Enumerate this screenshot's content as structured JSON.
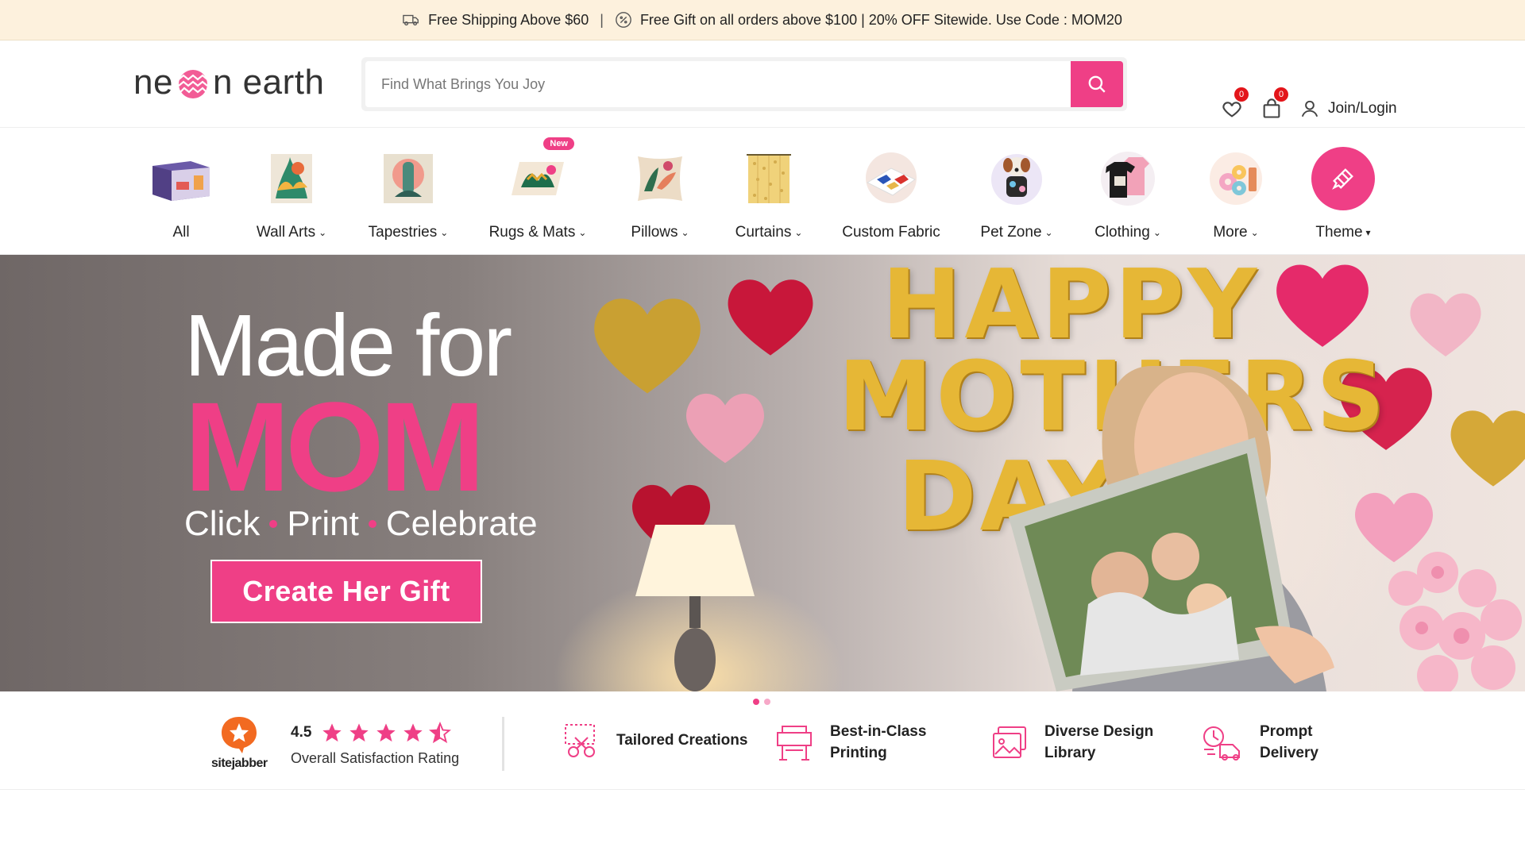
{
  "topbar": {
    "shipping": "Free Shipping Above $60",
    "separator": "|",
    "promo": "Free Gift on all orders above $100 | 20% OFF Sitewide. Use Code : MOM20"
  },
  "header": {
    "logo_left": "ne",
    "logo_right": "n earth",
    "search_placeholder": "Find What Brings You Joy",
    "wishlist_count": "0",
    "cart_count": "0",
    "login_label": "Join/Login"
  },
  "categories": [
    {
      "label": "All",
      "chevron": ""
    },
    {
      "label": "Wall Arts",
      "chevron": "⌄"
    },
    {
      "label": "Tapestries",
      "chevron": "⌄"
    },
    {
      "label": "Rugs & Mats",
      "chevron": "⌄",
      "badge": "New"
    },
    {
      "label": "Pillows",
      "chevron": "⌄"
    },
    {
      "label": "Curtains",
      "chevron": "⌄"
    },
    {
      "label": "Custom Fabric",
      "chevron": ""
    },
    {
      "label": "Pet Zone",
      "chevron": "⌄"
    },
    {
      "label": "Clothing",
      "chevron": "⌄"
    },
    {
      "label": "More",
      "chevron": "⌄"
    },
    {
      "label": "Theme",
      "chevron": "▾"
    }
  ],
  "hero": {
    "line1": "Made for",
    "line2": "MOM",
    "tag1": "Click",
    "tag2": "Print",
    "tag3": "Celebrate",
    "cta": "Create Her Gift",
    "balloon_text_1": "HAPPY",
    "balloon_text_2": "MOTHERS",
    "balloon_text_3": "DAY"
  },
  "carousel": {
    "slides": 2,
    "active": 0
  },
  "features": {
    "sitejabber": "sitejabber",
    "rating_value": "4.5",
    "rating_stars": 4.5,
    "rating_caption": "Overall Satisfaction Rating",
    "items": [
      {
        "line1": "Tailored Creations",
        "line2": ""
      },
      {
        "line1": "Best-in-Class",
        "line2": "Printing"
      },
      {
        "line1": "Diverse Design",
        "line2": "Library"
      },
      {
        "line1": "Prompt",
        "line2": "Delivery"
      }
    ]
  },
  "colors": {
    "accent": "#ef3f86",
    "topbar_bg": "#fdf1dd",
    "badge_red": "#e3151a",
    "sitejabber_orange": "#f26a21"
  }
}
